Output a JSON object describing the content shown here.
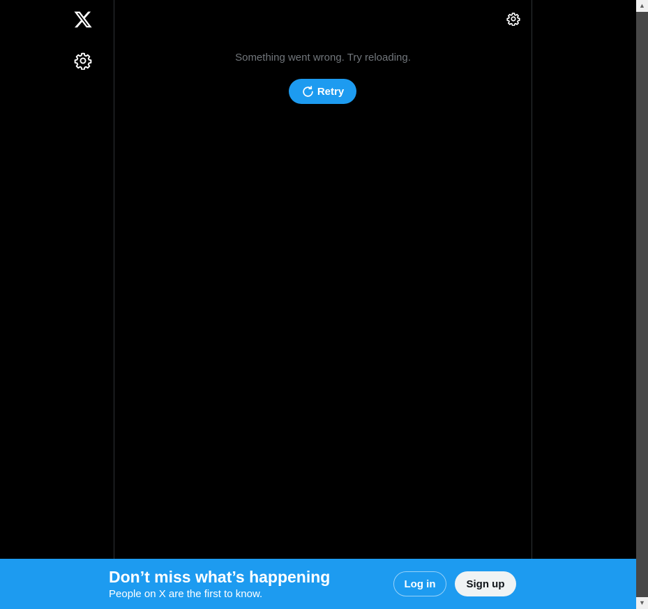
{
  "left_rail": {
    "logo_icon": "x-logo-icon",
    "settings_icon": "gear-icon"
  },
  "main": {
    "settings_icon": "gear-icon",
    "error_message": "Something went wrong. Try reloading.",
    "retry": {
      "icon": "refresh-icon",
      "label": "Retry"
    }
  },
  "bottom_bar": {
    "title": "Don’t miss what’s happening",
    "subtitle": "People on X are the first to know.",
    "login_label": "Log in",
    "signup_label": "Sign up"
  },
  "colors": {
    "background": "#000000",
    "accent": "#1d9bf0",
    "muted_text": "#71767b",
    "border": "#2f3336",
    "signup_bg": "#eff3f4"
  }
}
